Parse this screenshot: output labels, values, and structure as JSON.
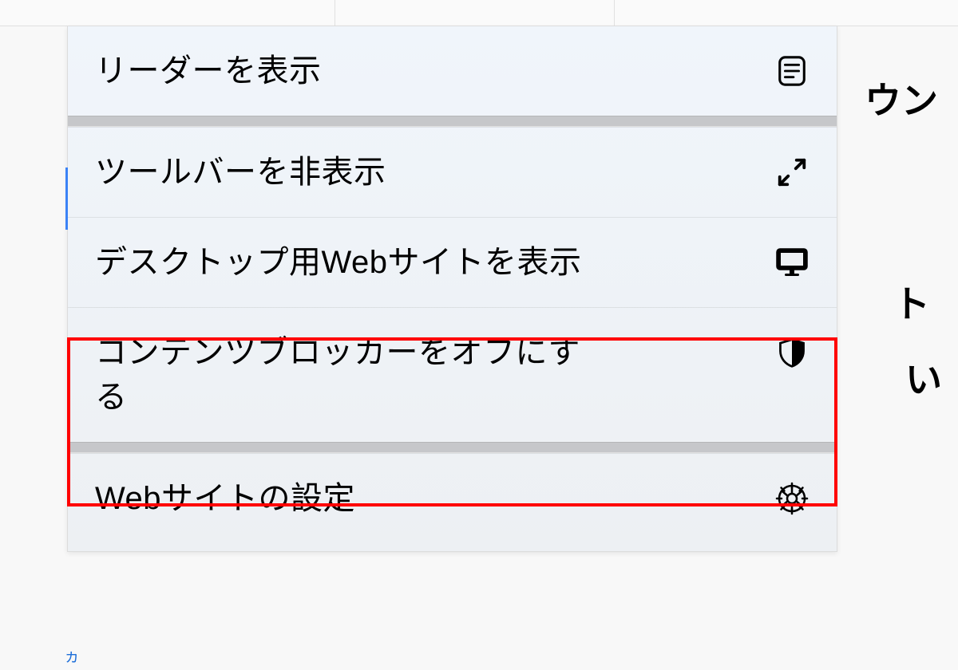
{
  "menu": {
    "items": [
      {
        "label": "リーダーを表示",
        "icon": "reader-icon"
      },
      {
        "label": "ツールバーを非表示",
        "icon": "arrows-diagonal-icon"
      },
      {
        "label": "デスクトップ用Webサイトを表示",
        "icon": "desktop-icon"
      },
      {
        "label": "コンテンツブロッカーをオフにする",
        "icon": "shield-icon"
      },
      {
        "label": "Webサイトの設定",
        "icon": "gear-icon"
      }
    ]
  },
  "background_fragments": {
    "frag1": "ウン",
    "frag2": "ト",
    "frag3": "い"
  },
  "highlight_index": 3,
  "small_marker": "ヵ"
}
